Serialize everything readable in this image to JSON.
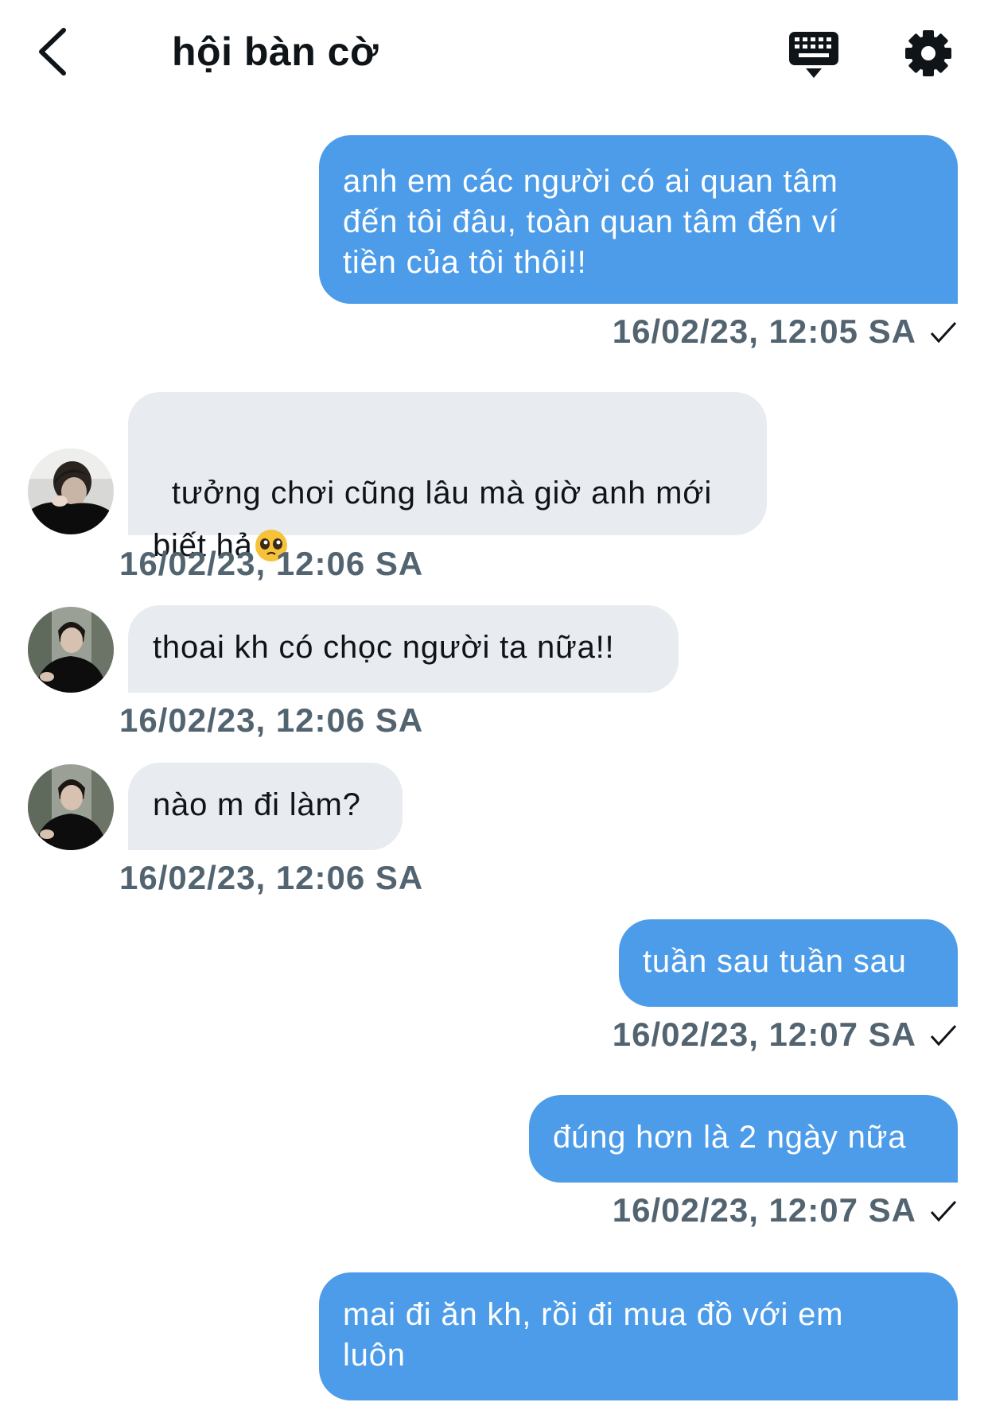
{
  "header": {
    "title": "hội bàn cờ",
    "back_icon": "chevron-left-icon",
    "keyboard_icon": "keyboard-icon",
    "settings_icon": "gear-icon"
  },
  "colors": {
    "outgoing_bubble": "#4c9ce9",
    "incoming_bubble": "#e8ecf0",
    "timestamp": "#536471"
  },
  "messages": [
    {
      "direction": "out",
      "text": "anh em các người có ai quan tâm\nđến tôi đâu, toàn quan tâm đến ví\ntiền của tôi thôi!!",
      "time": "16/02/23, 12:05 SA",
      "read": true
    },
    {
      "direction": "in",
      "text": "tưởng chơi cũng lâu mà giờ anh mới\nbiết hả",
      "emoji": "pleading-face-icon",
      "time": "16/02/23, 12:06 SA"
    },
    {
      "direction": "in",
      "text": "thoai kh có chọc người ta nữa!!",
      "time": "16/02/23, 12:06 SA"
    },
    {
      "direction": "in",
      "text": "nào m đi làm?",
      "time": "16/02/23, 12:06 SA"
    },
    {
      "direction": "out",
      "text": "tuần sau tuần sau",
      "time": "16/02/23, 12:07 SA",
      "read": true
    },
    {
      "direction": "out",
      "text": "đúng hơn là 2 ngày nữa",
      "time": "16/02/23, 12:07 SA",
      "read": true
    },
    {
      "direction": "out",
      "text": "mai đi ăn kh, rồi đi mua đồ với em\nluôn",
      "time": "",
      "read": false
    }
  ]
}
